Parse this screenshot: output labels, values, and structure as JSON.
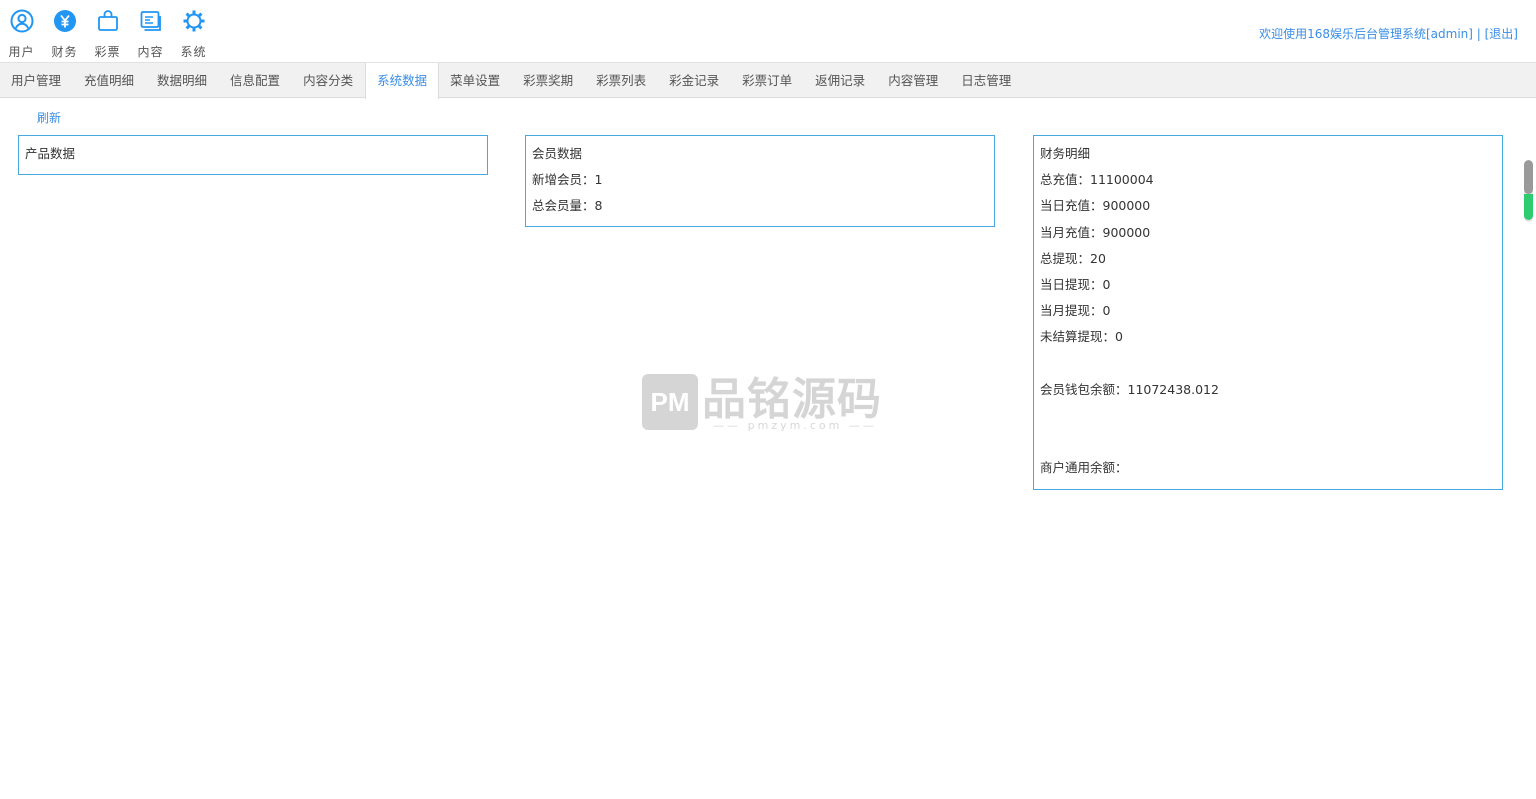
{
  "header": {
    "nav": [
      {
        "label": "用户",
        "icon": "user-icon"
      },
      {
        "label": "财务",
        "icon": "yen-icon"
      },
      {
        "label": "彩票",
        "icon": "bag-icon"
      },
      {
        "label": "内容",
        "icon": "content-icon"
      },
      {
        "label": "系统",
        "icon": "gear-icon"
      }
    ],
    "welcome_text": "欢迎使用168娱乐后台管理系统[admin]",
    "separator": " | ",
    "logout_label": "[退出]"
  },
  "tabs": [
    {
      "label": "用户管理",
      "active": false
    },
    {
      "label": "充值明细",
      "active": false
    },
    {
      "label": "数据明细",
      "active": false
    },
    {
      "label": "信息配置",
      "active": false
    },
    {
      "label": "内容分类",
      "active": false
    },
    {
      "label": "系统数据",
      "active": true
    },
    {
      "label": "菜单设置",
      "active": false
    },
    {
      "label": "彩票奖期",
      "active": false
    },
    {
      "label": "彩票列表",
      "active": false
    },
    {
      "label": "彩金记录",
      "active": false
    },
    {
      "label": "彩票订单",
      "active": false
    },
    {
      "label": "返佣记录",
      "active": false
    },
    {
      "label": "内容管理",
      "active": false
    },
    {
      "label": "日志管理",
      "active": false
    }
  ],
  "refresh_label": "刷新",
  "panels": {
    "product": {
      "title": "产品数据"
    },
    "member": {
      "title": "会员数据",
      "rows": [
        "新增会员：1",
        "总会员量：8"
      ]
    },
    "finance": {
      "title": "财务明细",
      "rows": [
        "总充值：11100004",
        "当日充值：900000",
        "当月充值：900000",
        "总提现：20",
        "当日提现：0",
        "当月提现：0",
        "未结算提现：0",
        "",
        "会员钱包余额：11072438.012",
        "",
        "",
        "商户通用余额："
      ]
    }
  },
  "watermark": {
    "logo": "PM",
    "text": "品铭源码",
    "sub": "—— pmzym.com ——"
  },
  "colors": {
    "accent": "#3a8ee6",
    "panel_border": "#4aa8e0",
    "tabbar_bg": "#f1f1f1"
  }
}
